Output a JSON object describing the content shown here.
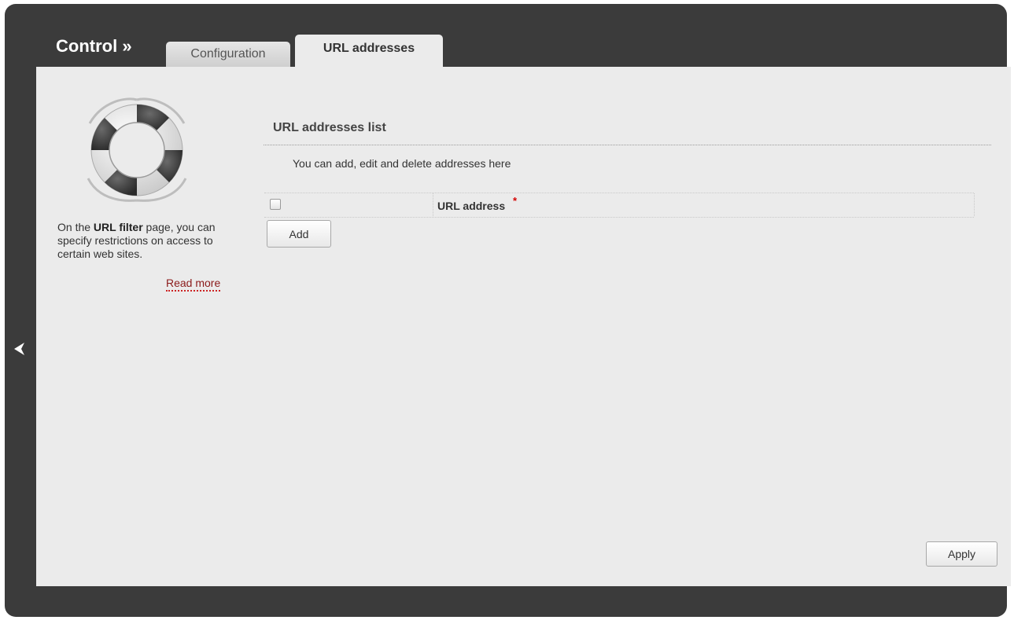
{
  "header": {
    "title": "Control »",
    "tabs": [
      {
        "label": "Configuration",
        "active": false
      },
      {
        "label": "URL addresses",
        "active": true
      }
    ]
  },
  "sidebar": {
    "icon": "lifebuoy-icon",
    "text_before": "On the ",
    "text_bold": "URL filter",
    "text_after": " page, you can specify restrictions on access to certain web sites.",
    "read_more": "Read more"
  },
  "main": {
    "section_title": "URL addresses list",
    "description": "You can add, edit and delete addresses here",
    "table": {
      "columns": [
        "URL address"
      ],
      "required_marker": "*",
      "select_all_checked": false,
      "rows": []
    },
    "add_label": "Add",
    "apply_label": "Apply"
  },
  "colors": {
    "frame": "#3b3b3b",
    "panel": "#ebebeb",
    "link": "#8b1a1a",
    "required": "#d40000"
  }
}
